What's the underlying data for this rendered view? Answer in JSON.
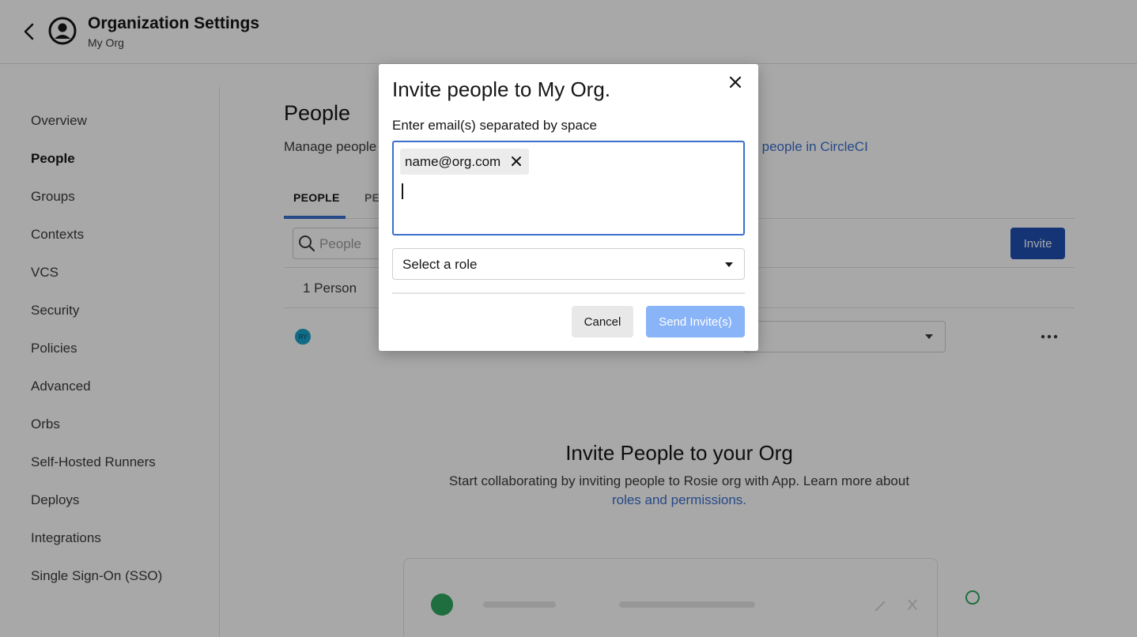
{
  "header": {
    "title": "Organization Settings",
    "subtitle": "My Org"
  },
  "sidebar": {
    "items": [
      {
        "label": "Overview"
      },
      {
        "label": "People"
      },
      {
        "label": "Groups"
      },
      {
        "label": "Contexts"
      },
      {
        "label": "VCS"
      },
      {
        "label": "Security"
      },
      {
        "label": "Policies"
      },
      {
        "label": "Advanced"
      },
      {
        "label": "Orbs"
      },
      {
        "label": "Self-Hosted Runners"
      },
      {
        "label": "Deploys"
      },
      {
        "label": "Integrations"
      },
      {
        "label": "Single Sign-On (SSO)"
      }
    ],
    "active": "People"
  },
  "main": {
    "title": "People",
    "description": "Manage people",
    "link_fragment": "ng people in CircleCI",
    "tabs": [
      {
        "label": "PEOPLE"
      },
      {
        "label": "PE"
      }
    ],
    "search_placeholder": "People",
    "invite_label": "Invite",
    "person_count": "1 Person",
    "avatar_initials": "RY",
    "empty_title": "Invite People to your Org",
    "empty_desc": "Start collaborating by inviting people to Rosie org with App. Learn more about",
    "empty_link": "roles and permissions."
  },
  "modal": {
    "title": "Invite people to My Org.",
    "label": "Enter email(s) separated by space",
    "chip": "name@org.com",
    "role_placeholder": "Select a role",
    "cancel_label": "Cancel",
    "send_label": "Send Invite(s)"
  },
  "colors": {
    "accent": "#3b6fcf",
    "primary_button": "#1f4fb3",
    "disabled_button": "#8ab4f8"
  }
}
